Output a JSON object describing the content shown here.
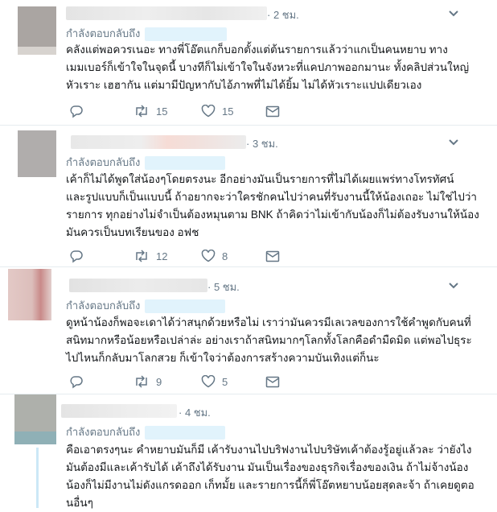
{
  "colors": {
    "muted": "#657786",
    "mention_bg": "#e1f3fc",
    "divider": "#e6ecf0",
    "thread_line": "#cce8f7"
  },
  "tweets": [
    {
      "time": "· 2 ชม.",
      "reply_label": "กำลังตอบกลับถึง",
      "lines": [
        "คลังแต่พอควรเนอะ ทางพี่โอ๊ตแกก็บอกตั้งแต่ต้นรายการแล้วว่าแกเป็นคนหยาบ ทาง",
        "เมมเบอร์ก็เข้าใจในจุดนี้ บางทีก็ไม่เข้าใจในจังหวะที่แคปภาพออกมานะ ทั้งคลิปส่วนใหญ่",
        "หัวเราะ เฮฮากัน แต่มามีปัญหากับไอ้ภาพที่ไม่ได้ยิ้ม ไม่ได้หัวเราะแปปเดียวเอง"
      ],
      "retweets": "15",
      "likes": "15"
    },
    {
      "time": "· 3 ชม.",
      "reply_label": "กำลังตอบกลับถึง",
      "lines": [
        "เค้าก็ไม่ได้พูดใส่น้องๆโดยตรงนะ อีกอย่างมันเป็นรายการที่ไม่ได้เผยแพร่ทางโทรทัศน์",
        "และรูปแบบก็เป็นแบบนี้ ถ้าอยากจะว่าใครชักคนไปว่าคนที่รับงานนี้ให้น้องเถอะ ไม่ใช่ไปว่า",
        "รายการ ทุกอย่างไม่จำเป็นต้องหมุนตาม BNK ถ้าคิดว่าไม่เข้ากับน้องก็ไม่ต้องรับงานให้น้อง",
        "มันควรเป็นบทเรียนของ อฟช"
      ],
      "retweets": "12",
      "likes": "8"
    },
    {
      "time": "· 5 ชม.",
      "reply_label": "กำลังตอบกลับถึง",
      "lines": [
        "ดูหน้าน้องก็พอจะเดาได้ว่าสนุกด้วยหรือไม่ เราว่ามันควรมีเลเวลของการใช้คำพูดกับคนที่",
        "สนิทมากหรือน้อยหรือเปล่าล่ะ อย่างเราถ้าสนิทมากๆโลกทั้งโลกคือดำมืดมิด แต่พอไปธุระ",
        "ไปไหนก็กลับมาโลกสวย ก็เข้าใจว่าต้องการสร้างความบันเทิงแต่ก็นะ"
      ],
      "retweets": "9",
      "likes": "5"
    },
    {
      "time": "· 4 ชม.",
      "reply_label": "กำลังตอบกลับถึง",
      "lines": [
        "คือเอาตรงๆนะ คำหยาบมันก็มี เค้ารับงานไปบริฟงานไปบริษัทเค้าต้องรู้อยู่แล้วละ ว่ายังไง",
        "มันต้องมีและเค้ารับได้ เค้าถึงได้รับงาน มันเป็นเรื่องของธุรกิจเรื่องของเงิน ถ้าไม่จ้างน้อง",
        "น้องก็ไม่มีงานไม่ดังแกรดออก เก็ทมั้ย และรายการนี้ก็พี่โอ๊ตหยาบน้อยสุดละจ้า ถ้าเคยดูตอ",
        "นอื่นๆ"
      ]
    }
  ]
}
